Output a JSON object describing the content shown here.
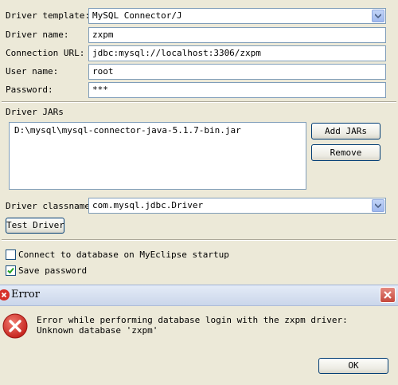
{
  "form": {
    "driver_template_label": "Driver template:",
    "driver_template_value": "MySQL Connector/J",
    "driver_name_label": "Driver name:",
    "driver_name_value": "zxpm",
    "connection_url_label": "Connection URL:",
    "connection_url_value": "jdbc:mysql://localhost:3306/zxpm",
    "user_name_label": "User name:",
    "user_name_value": "root",
    "password_label": "Password:",
    "password_value": "***"
  },
  "jars": {
    "section_label": "Driver JARs",
    "items": [
      "D:\\mysql\\mysql-connector-java-5.1.7-bin.jar"
    ],
    "add_button": "Add JARs",
    "remove_button": "Remove"
  },
  "classname": {
    "label": "Driver classname:",
    "value": "com.mysql.jdbc.Driver"
  },
  "test_button": "Test Driver",
  "options": {
    "connect_startup_label": "Connect to database on MyEclipse startup",
    "connect_startup_checked": false,
    "save_password_label": "Save password",
    "save_password_checked": true
  },
  "error_dialog": {
    "title": "Error",
    "message_line1": "Error while performing database login with the zxpm driver:",
    "message_line2": "Unknown database 'zxpm'",
    "ok_button": "OK"
  },
  "colors": {
    "window_bg": "#ece9d8",
    "field_border": "#7f9db9",
    "close_button": "#c5483c",
    "error_icon": "#d6302a"
  },
  "icons": {
    "combo_arrow": "chevron-down-icon",
    "checkmark": "checkmark-icon",
    "dialog_title_icon": "error-title-icon",
    "dialog_close": "close-icon",
    "dialog_message_icon": "error-icon"
  }
}
